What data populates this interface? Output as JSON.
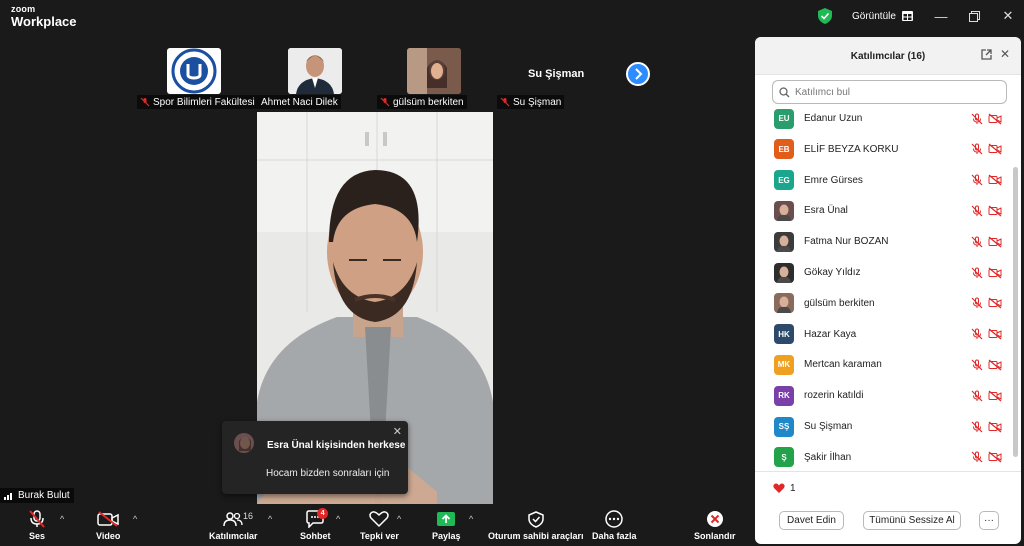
{
  "app": {
    "brand_small": "zoom",
    "brand_large": "Workplace",
    "view_label": "Görüntüle"
  },
  "thumbnails": [
    {
      "name": "Spor Bilimleri Fakültesi",
      "muted": true
    },
    {
      "name": "Ahmet Naci Dilek",
      "muted": false
    },
    {
      "name": "gülsüm berkiten",
      "muted": true
    },
    {
      "name": "Su Şişman",
      "muted": true
    }
  ],
  "name_tile": "Su Şişman",
  "speaker": {
    "name": "Burak Bulut"
  },
  "toast": {
    "title": "Esra Ünal kişisinden herkese",
    "message": "Hocam bizden sonraları için"
  },
  "toolbar": {
    "audio": "Ses",
    "video": "Video",
    "participants": "Katılımcılar",
    "participants_count": "16",
    "chat": "Sohbet",
    "chat_badge": "4",
    "react": "Tepki ver",
    "share": "Paylaş",
    "host_tools": "Oturum sahibi araçları",
    "more": "Daha fazla",
    "end": "Sonlandır"
  },
  "panel": {
    "title": "Katılımcılar (16)",
    "search_placeholder": "Katılımcı bul",
    "participants": [
      {
        "initials": "EU",
        "name": "Edanur Uzun",
        "color": "#2a9d6d"
      },
      {
        "initials": "EB",
        "name": "ELİF BEYZA KORKU",
        "color": "#e25c1b"
      },
      {
        "initials": "EG",
        "name": "Emre Gürses",
        "color": "#1aa68c"
      },
      {
        "initials": "",
        "name": "Esra Ünal",
        "color": "#6b4f4f"
      },
      {
        "initials": "",
        "name": "Fatma Nur BOZAN",
        "color": "#3b3b3b"
      },
      {
        "initials": "",
        "name": "Gökay Yıldız",
        "color": "#2d2d2d"
      },
      {
        "initials": "",
        "name": "gülsüm berkiten",
        "color": "#8a6a5a"
      },
      {
        "initials": "HK",
        "name": "Hazar Kaya",
        "color": "#2d4a6b"
      },
      {
        "initials": "MK",
        "name": "Mertcan karaman",
        "color": "#f0a020"
      },
      {
        "initials": "RK",
        "name": "rozerin katıldi",
        "color": "#7a3fa8"
      },
      {
        "initials": "SŞ",
        "name": "Su Şişman",
        "color": "#1e88c8"
      },
      {
        "initials": "Ş",
        "name": "Şakir İlhan",
        "color": "#22a34a"
      }
    ],
    "reaction_count": "1",
    "invite": "Davet Edin",
    "mute_all": "Tümünü Sessize Al",
    "more": "···"
  }
}
